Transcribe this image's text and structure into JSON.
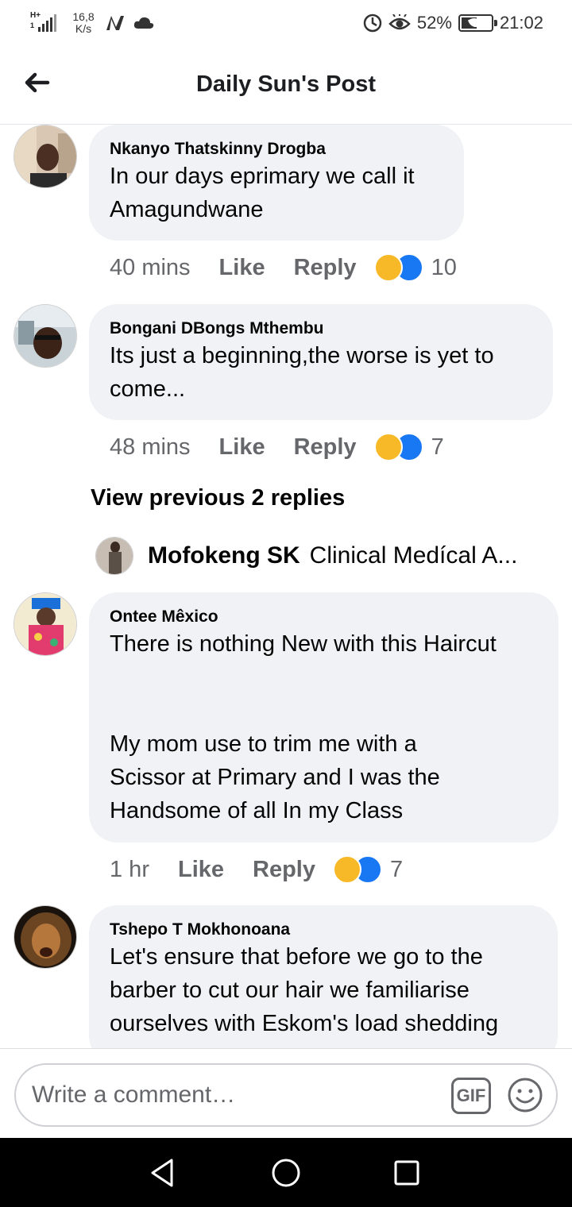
{
  "status_bar": {
    "network": "H+",
    "network_sub": "1",
    "speed_value": "16,8",
    "speed_unit": "K/s",
    "battery_percent": "52%",
    "battery_level": 0.52,
    "time": "21:02"
  },
  "header": {
    "title": "Daily Sun's Post"
  },
  "comments": [
    {
      "author": "Nkanyo Thatskinny Drogba",
      "text": "In our days eprimary we call it\nAmagundwane",
      "time": "40 mins",
      "like_label": "Like",
      "reply_label": "Reply",
      "reaction_count": "10"
    },
    {
      "author": "Bongani DBongs Mthembu",
      "text": "Its just a beginning,the worse is yet to\ncome...",
      "time": "48 mins",
      "like_label": "Like",
      "reply_label": "Reply",
      "reaction_count": "7"
    },
    {
      "author": "Ontee Mêxico",
      "text": "There is nothing New with this Haircut\n\n\nMy mom use to trim me with a\nScissor at Primary and I was the\nHandsome of all In my Class",
      "time": "1 hr",
      "like_label": "Like",
      "reply_label": "Reply",
      "reaction_count": "7"
    },
    {
      "author": "Tshepo T Mokhonoana",
      "text": "Let's ensure that before we go to the\nbarber to cut our hair we familiarise\nourselves with Eskom's load shedding"
    }
  ],
  "replies_thread": {
    "view_previous_label": "View previous 2 replies",
    "preview_author": "Mofokeng SK",
    "preview_text": "Clinical Medícal A..."
  },
  "composer": {
    "placeholder": "Write a comment…",
    "gif_label": "GIF"
  },
  "colors": {
    "bubble": "#f0f2f5",
    "meta_text": "#65676b",
    "like_blue": "#1877f2",
    "haha_yellow": "#f7b928",
    "nav_bg": "#000000"
  }
}
